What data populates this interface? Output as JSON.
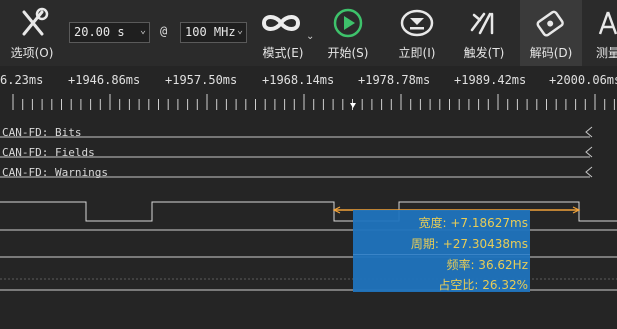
{
  "toolbar": {
    "options_label": "选项(O)",
    "duration_value": "20.00 s",
    "at_symbol": "@",
    "rate_value": "100 MHz",
    "mode_label": "模式(E)",
    "start_label": "开始(S)",
    "instant_label": "立即(I)",
    "trigger_label": "触发(T)",
    "decode_label": "解码(D)",
    "measure_label": "测量"
  },
  "ruler": {
    "labels": [
      "6.23ms",
      "+1946.86ms",
      "+1957.50ms",
      "+1968.14ms",
      "+1978.78ms",
      "+1989.42ms",
      "+2000.06ms"
    ]
  },
  "channels": [
    {
      "label": "CAN-FD: Bits"
    },
    {
      "label": "CAN-FD: Fields"
    },
    {
      "label": "CAN-FD: Warnings"
    }
  ],
  "measurement": {
    "width": "宽度: +7.18627ms",
    "period": "周期: +27.30438ms",
    "frequency": "频率: 36.62Hz",
    "duty": "占空比: 26.32%"
  },
  "colors": {
    "toolbar_bg": "#2b2b2b",
    "background": "#252525",
    "start_green": "#3ec26b",
    "measure_bg": "#1f73bd",
    "measure_text": "#f3d65a",
    "highlight_orange": "#f0a23a"
  }
}
